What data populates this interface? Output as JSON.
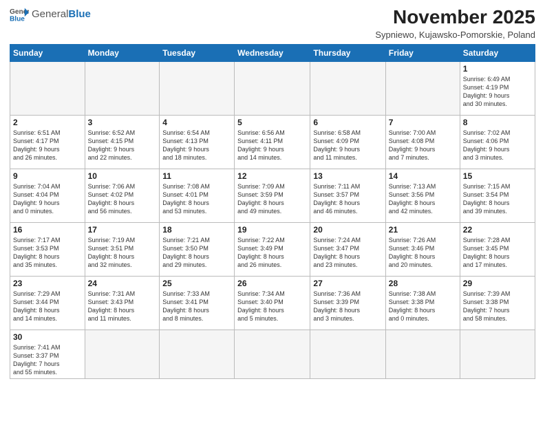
{
  "header": {
    "logo_general": "General",
    "logo_blue": "Blue",
    "month": "November 2025",
    "location": "Sypniewo, Kujawsko-Pomorskie, Poland"
  },
  "weekdays": [
    "Sunday",
    "Monday",
    "Tuesday",
    "Wednesday",
    "Thursday",
    "Friday",
    "Saturday"
  ],
  "weeks": [
    [
      {
        "day": "",
        "info": ""
      },
      {
        "day": "",
        "info": ""
      },
      {
        "day": "",
        "info": ""
      },
      {
        "day": "",
        "info": ""
      },
      {
        "day": "",
        "info": ""
      },
      {
        "day": "",
        "info": ""
      },
      {
        "day": "1",
        "info": "Sunrise: 6:49 AM\nSunset: 4:19 PM\nDaylight: 9 hours\nand 30 minutes."
      }
    ],
    [
      {
        "day": "2",
        "info": "Sunrise: 6:51 AM\nSunset: 4:17 PM\nDaylight: 9 hours\nand 26 minutes."
      },
      {
        "day": "3",
        "info": "Sunrise: 6:52 AM\nSunset: 4:15 PM\nDaylight: 9 hours\nand 22 minutes."
      },
      {
        "day": "4",
        "info": "Sunrise: 6:54 AM\nSunset: 4:13 PM\nDaylight: 9 hours\nand 18 minutes."
      },
      {
        "day": "5",
        "info": "Sunrise: 6:56 AM\nSunset: 4:11 PM\nDaylight: 9 hours\nand 14 minutes."
      },
      {
        "day": "6",
        "info": "Sunrise: 6:58 AM\nSunset: 4:09 PM\nDaylight: 9 hours\nand 11 minutes."
      },
      {
        "day": "7",
        "info": "Sunrise: 7:00 AM\nSunset: 4:08 PM\nDaylight: 9 hours\nand 7 minutes."
      },
      {
        "day": "8",
        "info": "Sunrise: 7:02 AM\nSunset: 4:06 PM\nDaylight: 9 hours\nand 3 minutes."
      }
    ],
    [
      {
        "day": "9",
        "info": "Sunrise: 7:04 AM\nSunset: 4:04 PM\nDaylight: 9 hours\nand 0 minutes."
      },
      {
        "day": "10",
        "info": "Sunrise: 7:06 AM\nSunset: 4:02 PM\nDaylight: 8 hours\nand 56 minutes."
      },
      {
        "day": "11",
        "info": "Sunrise: 7:08 AM\nSunset: 4:01 PM\nDaylight: 8 hours\nand 53 minutes."
      },
      {
        "day": "12",
        "info": "Sunrise: 7:09 AM\nSunset: 3:59 PM\nDaylight: 8 hours\nand 49 minutes."
      },
      {
        "day": "13",
        "info": "Sunrise: 7:11 AM\nSunset: 3:57 PM\nDaylight: 8 hours\nand 46 minutes."
      },
      {
        "day": "14",
        "info": "Sunrise: 7:13 AM\nSunset: 3:56 PM\nDaylight: 8 hours\nand 42 minutes."
      },
      {
        "day": "15",
        "info": "Sunrise: 7:15 AM\nSunset: 3:54 PM\nDaylight: 8 hours\nand 39 minutes."
      }
    ],
    [
      {
        "day": "16",
        "info": "Sunrise: 7:17 AM\nSunset: 3:53 PM\nDaylight: 8 hours\nand 35 minutes."
      },
      {
        "day": "17",
        "info": "Sunrise: 7:19 AM\nSunset: 3:51 PM\nDaylight: 8 hours\nand 32 minutes."
      },
      {
        "day": "18",
        "info": "Sunrise: 7:21 AM\nSunset: 3:50 PM\nDaylight: 8 hours\nand 29 minutes."
      },
      {
        "day": "19",
        "info": "Sunrise: 7:22 AM\nSunset: 3:49 PM\nDaylight: 8 hours\nand 26 minutes."
      },
      {
        "day": "20",
        "info": "Sunrise: 7:24 AM\nSunset: 3:47 PM\nDaylight: 8 hours\nand 23 minutes."
      },
      {
        "day": "21",
        "info": "Sunrise: 7:26 AM\nSunset: 3:46 PM\nDaylight: 8 hours\nand 20 minutes."
      },
      {
        "day": "22",
        "info": "Sunrise: 7:28 AM\nSunset: 3:45 PM\nDaylight: 8 hours\nand 17 minutes."
      }
    ],
    [
      {
        "day": "23",
        "info": "Sunrise: 7:29 AM\nSunset: 3:44 PM\nDaylight: 8 hours\nand 14 minutes."
      },
      {
        "day": "24",
        "info": "Sunrise: 7:31 AM\nSunset: 3:43 PM\nDaylight: 8 hours\nand 11 minutes."
      },
      {
        "day": "25",
        "info": "Sunrise: 7:33 AM\nSunset: 3:41 PM\nDaylight: 8 hours\nand 8 minutes."
      },
      {
        "day": "26",
        "info": "Sunrise: 7:34 AM\nSunset: 3:40 PM\nDaylight: 8 hours\nand 5 minutes."
      },
      {
        "day": "27",
        "info": "Sunrise: 7:36 AM\nSunset: 3:39 PM\nDaylight: 8 hours\nand 3 minutes."
      },
      {
        "day": "28",
        "info": "Sunrise: 7:38 AM\nSunset: 3:38 PM\nDaylight: 8 hours\nand 0 minutes."
      },
      {
        "day": "29",
        "info": "Sunrise: 7:39 AM\nSunset: 3:38 PM\nDaylight: 7 hours\nand 58 minutes."
      }
    ],
    [
      {
        "day": "30",
        "info": "Sunrise: 7:41 AM\nSunset: 3:37 PM\nDaylight: 7 hours\nand 55 minutes."
      },
      {
        "day": "",
        "info": ""
      },
      {
        "day": "",
        "info": ""
      },
      {
        "day": "",
        "info": ""
      },
      {
        "day": "",
        "info": ""
      },
      {
        "day": "",
        "info": ""
      },
      {
        "day": "",
        "info": ""
      }
    ]
  ]
}
